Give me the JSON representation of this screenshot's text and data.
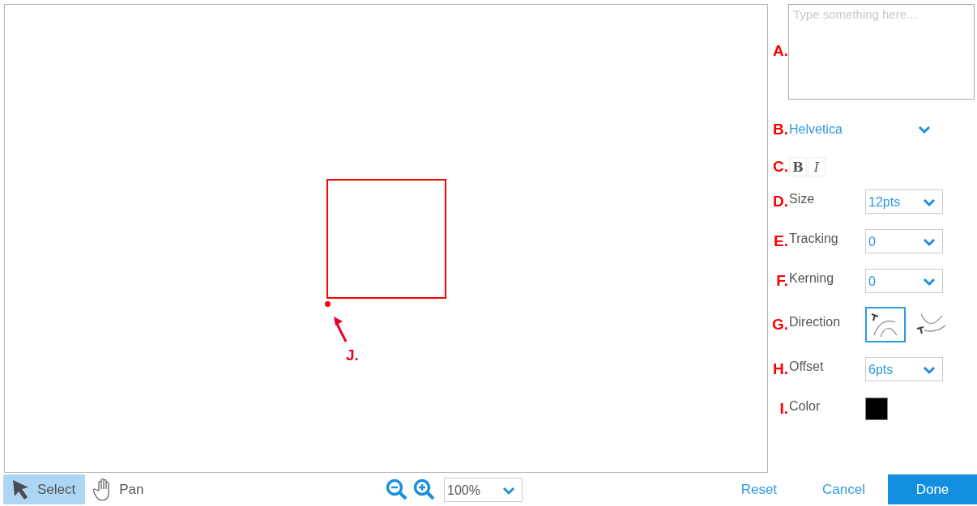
{
  "canvas": {
    "annotation": {
      "letter": "J."
    }
  },
  "panel": {
    "text_input": {
      "letter": "A.",
      "placeholder": "Type something here..."
    },
    "font": {
      "letter": "B.",
      "value": "Helvetica"
    },
    "style": {
      "letter": "C.",
      "buttons": [
        {
          "label": "B",
          "kind": "bold",
          "selected": false
        },
        {
          "label": "I",
          "kind": "italic",
          "selected": false
        }
      ]
    },
    "fields": [
      {
        "letter": "D.",
        "label": "Size",
        "kind": "select",
        "value": "12pts"
      },
      {
        "letter": "E.",
        "label": "Tracking",
        "kind": "select",
        "value": "0"
      },
      {
        "letter": "F.",
        "label": "Kerning",
        "kind": "select",
        "value": "0"
      },
      {
        "letter": "G.",
        "label": "Direction",
        "kind": "direction",
        "options": [
          {
            "kind": "arc-over",
            "selected": true
          },
          {
            "kind": "arc-under",
            "selected": false
          }
        ]
      },
      {
        "letter": "H.",
        "label": "Offset",
        "kind": "select",
        "value": "6pts"
      },
      {
        "letter": "I.",
        "label": "Color",
        "kind": "color",
        "color": "#000000"
      }
    ]
  },
  "toolbar": {
    "tools": [
      {
        "label": "Select",
        "kind": "select",
        "selected": true
      },
      {
        "label": "Pan",
        "kind": "pan",
        "selected": false
      }
    ],
    "zoom": {
      "value": "100%"
    },
    "buttons": [
      {
        "label": "Reset",
        "kind": "link"
      },
      {
        "label": "Cancel",
        "kind": "link"
      },
      {
        "label": "Done",
        "kind": "primary"
      }
    ]
  }
}
